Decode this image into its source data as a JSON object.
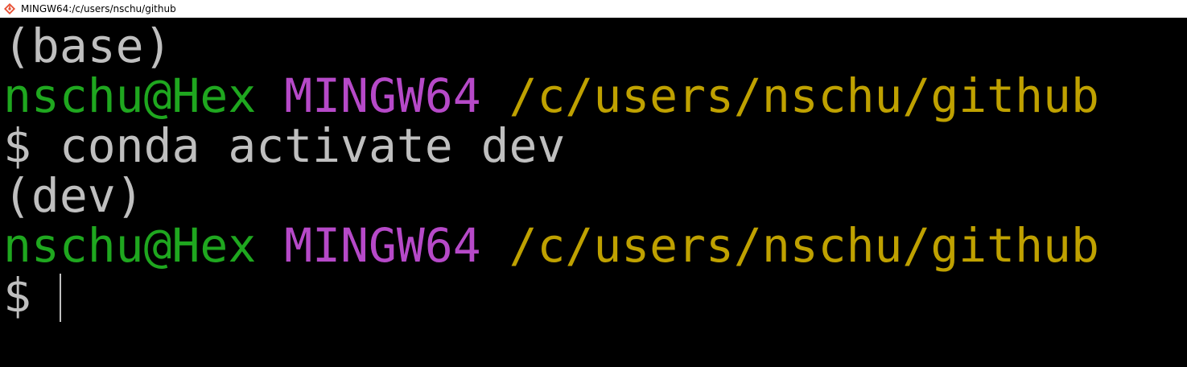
{
  "window": {
    "title": "MINGW64:/c/users/nschu/github"
  },
  "colors": {
    "background": "#000000",
    "default_text": "#bfbfbf",
    "user_host": "#1fa71f",
    "system": "#b649c8",
    "path": "#bfa100"
  },
  "terminal": {
    "lines": [
      {
        "env": "(base)"
      },
      {
        "user_host": "nschu@Hex",
        "system": "MINGW64",
        "path": "/c/users/nschu/github"
      },
      {
        "prompt": "$",
        "command": "conda activate dev"
      },
      {
        "env": "(dev)"
      },
      {
        "user_host": "nschu@Hex",
        "system": "MINGW64",
        "path": "/c/users/nschu/github"
      },
      {
        "prompt": "$",
        "command": ""
      }
    ]
  }
}
